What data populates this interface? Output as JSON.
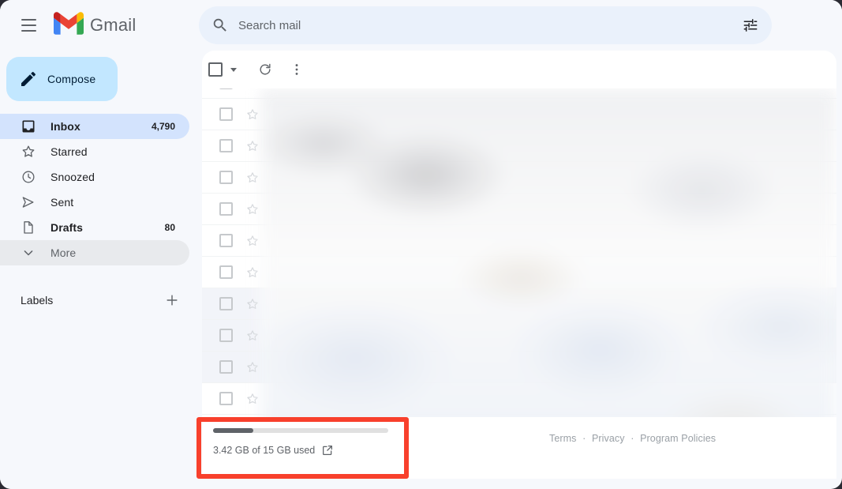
{
  "app": {
    "brand_name": "Gmail",
    "accent_blue": "#c2e7ff",
    "selected_blue": "#d3e3fd",
    "highlight_red": "#f8402c"
  },
  "header": {
    "menu_icon": "hamburger-menu-icon",
    "logo_icon": "gmail-logo-icon"
  },
  "search": {
    "placeholder": "Search mail",
    "value": "",
    "search_icon": "search-icon",
    "options_icon": "tune-options-icon"
  },
  "sidebar": {
    "compose": {
      "label": "Compose",
      "icon": "pencil-icon"
    },
    "items": [
      {
        "label": "Inbox",
        "count": "4,790",
        "icon": "inbox-icon",
        "active": true,
        "bold": true
      },
      {
        "label": "Starred",
        "count": "",
        "icon": "star-icon",
        "active": false,
        "bold": false
      },
      {
        "label": "Snoozed",
        "count": "",
        "icon": "clock-icon",
        "active": false,
        "bold": false
      },
      {
        "label": "Sent",
        "count": "",
        "icon": "send-icon",
        "active": false,
        "bold": false
      },
      {
        "label": "Drafts",
        "count": "80",
        "icon": "document-icon",
        "active": false,
        "bold": true
      },
      {
        "label": "More",
        "count": "",
        "icon": "chevron-down-icon",
        "active": false,
        "bold": false
      }
    ],
    "labels_section": {
      "label": "Labels",
      "add_icon": "plus-icon"
    }
  },
  "toolbar": {
    "select_all_checkbox": "select-all-checkbox",
    "select_dropdown_icon": "chevron-down-icon",
    "refresh_icon": "refresh-icon",
    "more_options_icon": "three-dot-menu-icon"
  },
  "mail_list": {
    "rows": [
      {
        "unread": false
      },
      {
        "unread": false
      },
      {
        "unread": false
      },
      {
        "unread": false
      },
      {
        "unread": false
      },
      {
        "unread": false
      },
      {
        "unread": false
      },
      {
        "unread": true
      },
      {
        "unread": true
      },
      {
        "unread": true
      },
      {
        "unread": false
      }
    ],
    "checkbox_icon": "checkbox-icon",
    "star_icon": "star-outline-icon"
  },
  "storage": {
    "text": "3.42 GB of 15 GB used",
    "used_gb": 3.42,
    "total_gb": 15,
    "percent_used": 22.8,
    "manage_icon": "external-link-icon"
  },
  "footer": {
    "terms": "Terms",
    "privacy": "Privacy",
    "program_policies": "Program Policies",
    "separator": "·"
  }
}
